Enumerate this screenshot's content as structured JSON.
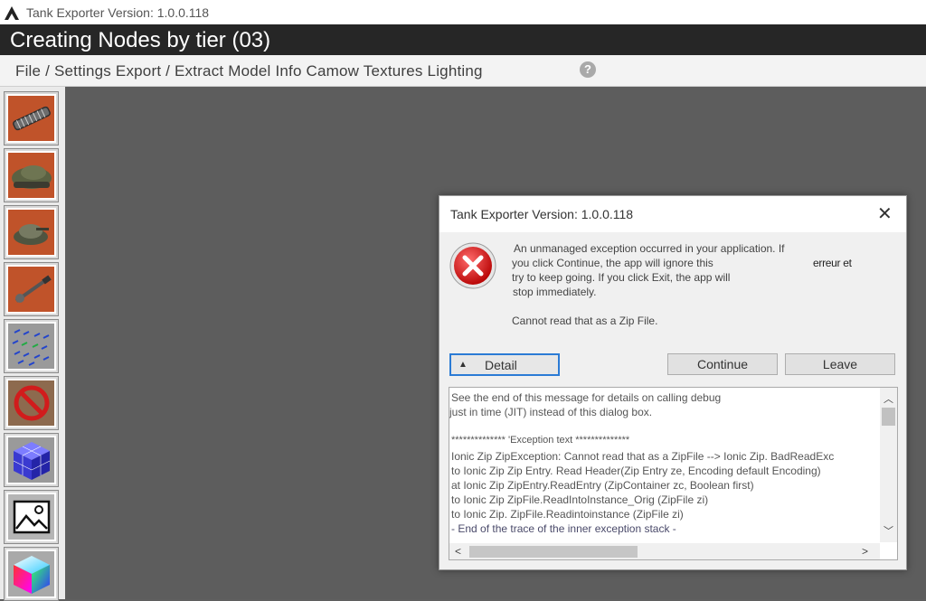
{
  "app": {
    "window_title": "Tank Exporter Version: 1.0.0.118",
    "heading": "Creating Nodes by tier (03)",
    "menu_text": "File / Settings Export / Extract Model Info Camow Textures Lighting",
    "help_label": "?"
  },
  "toolbar": {
    "items": [
      {
        "icon": "track-icon"
      },
      {
        "icon": "tank-hull-icon"
      },
      {
        "icon": "turret-icon"
      },
      {
        "icon": "gun-icon"
      },
      {
        "icon": "normals-icon"
      },
      {
        "icon": "no-symbol-icon"
      },
      {
        "icon": "cube-grid-icon"
      },
      {
        "icon": "image-icon"
      },
      {
        "icon": "color-cube-icon"
      }
    ]
  },
  "dialog": {
    "title": "Tank Exporter Version: 1.0.0.118",
    "close_label": "✕",
    "message_lines": [
      "An unmanaged exception occurred in your application. If",
      "you click Continue, the app will ignore this",
      "try to keep going. If you click Exit, the app will",
      "stop immediately."
    ],
    "message_extra": "erreur et",
    "sub_message": "Cannot read that as a Zip File.",
    "detail_label": "Detail",
    "continue_label": "Continue",
    "leave_label": "Leave",
    "details_lines": [
      "See the end of this message for details on calling debug",
      "just in time (JIT) instead of this dialog box.",
      "",
      "************** 'Exception text              **************",
      "Ionic Zip ZipException: Cannot read that as a ZipFile --> Ionic Zip. BadReadExc",
      "   to Ionic Zip Zip Entry. Read Header(Zip Entry ze, Encoding default Encoding)",
      "   at Ionic Zip ZipEntry.ReadEntry (ZipContainer zc, Boolean first)",
      "   to Ionic Zip ZipFile.ReadIntoInstance_Orig (ZipFile zi)",
      "   to Ionic Zip. ZipFile.Readintoinstance (ZipFile zi)",
      "   - End of the trace of the inner exception stack -"
    ]
  },
  "colors": {
    "header_bg": "#262626",
    "workspace_bg": "#5d5d5d",
    "tool_orange": "#c0532a",
    "error_red": "#d11c1c",
    "focus_blue": "#2b7bd5"
  }
}
